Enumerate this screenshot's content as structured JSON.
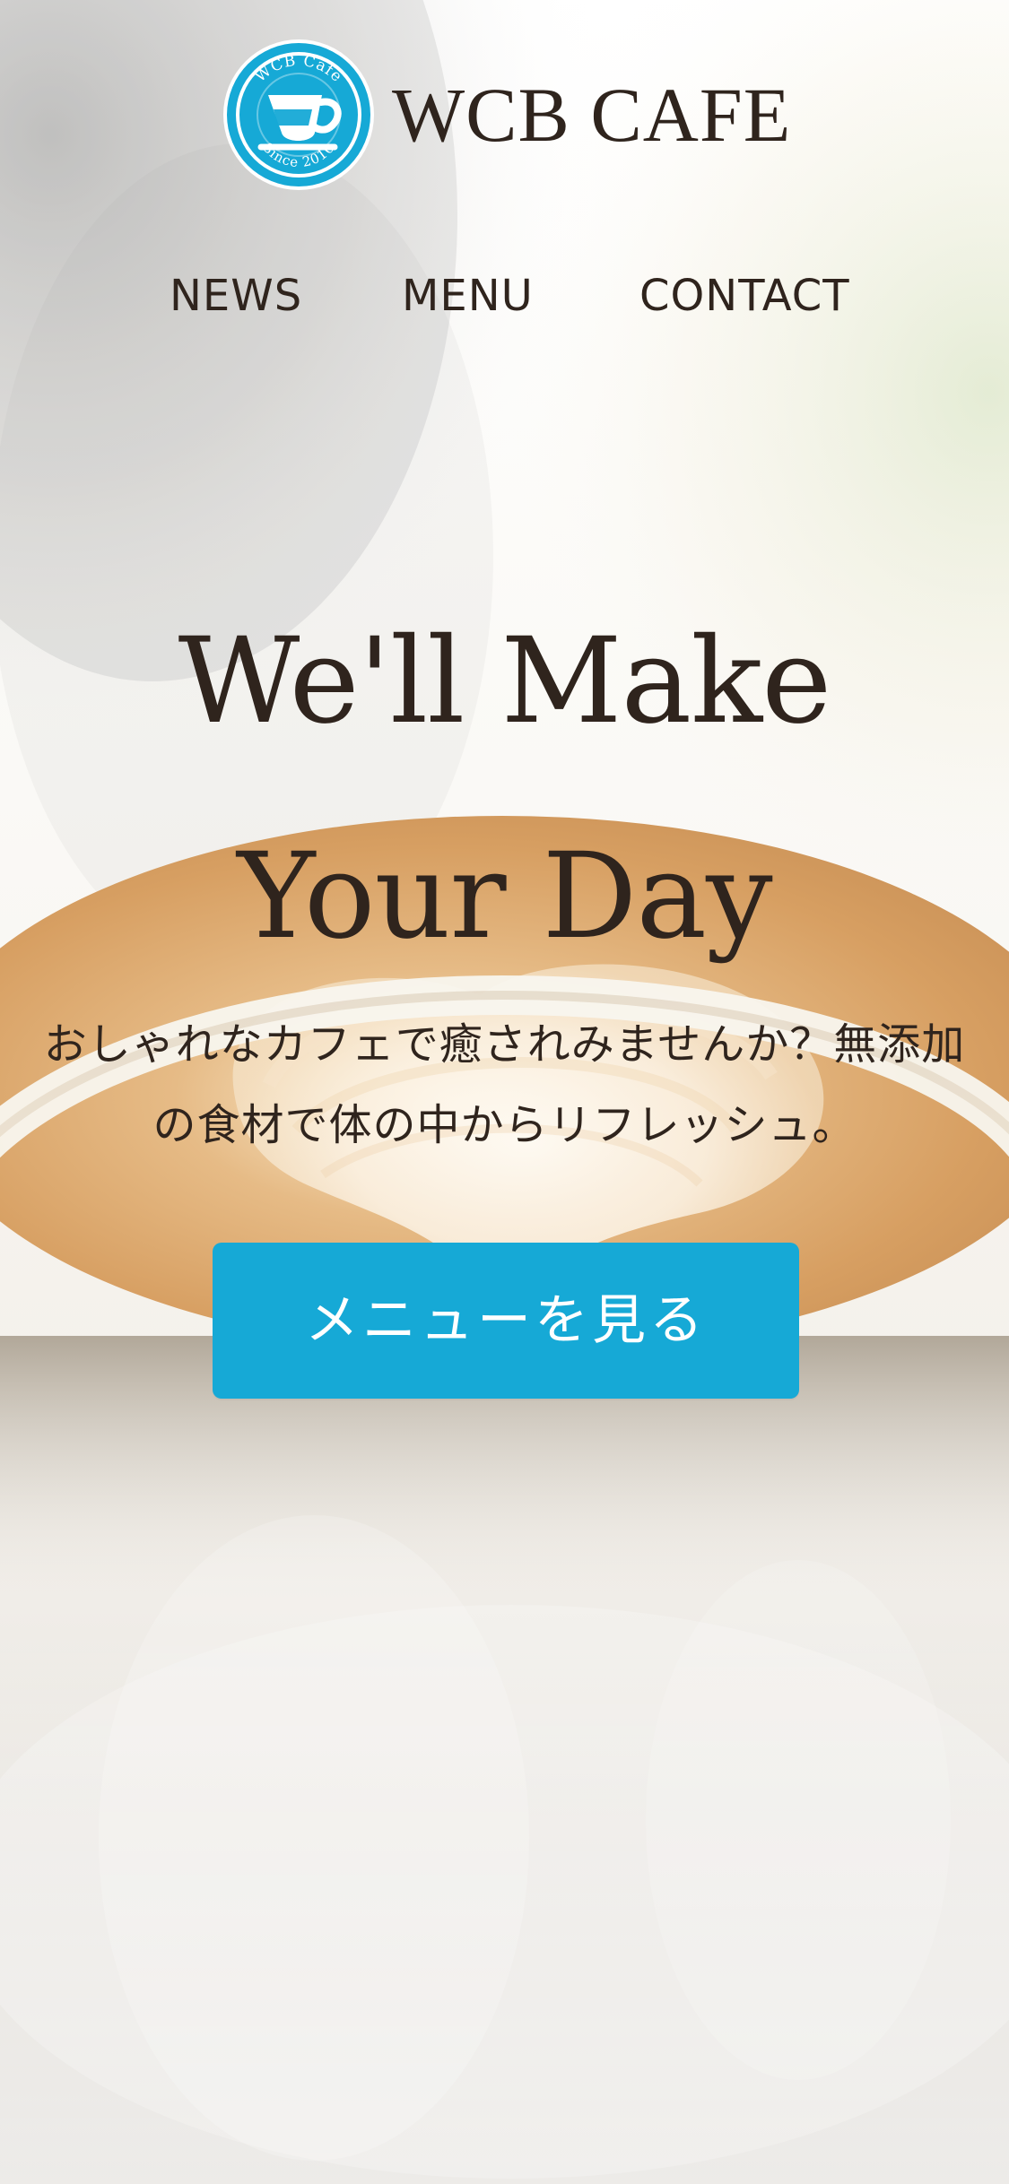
{
  "header": {
    "brand_name": "WCB CAFE",
    "logo": {
      "top_text": "WCB Cafe",
      "bottom_text": "Since 2010"
    }
  },
  "nav": {
    "items": [
      {
        "label": "NEWS"
      },
      {
        "label": "MENU"
      },
      {
        "label": "CONTACT"
      }
    ]
  },
  "hero": {
    "title": "We'll Make Your Day",
    "description": "おしゃれなカフェで癒されみませんか？無添加の食材で体の中からリフレッシュ。",
    "button_label": "メニューを見る"
  },
  "theme": {
    "accent": "#16a9d6",
    "text": "#2f241d",
    "foam": "#d2a06c",
    "cup": "#f2efe8"
  },
  "icons": {
    "logo": "cafe-logo-icon"
  }
}
